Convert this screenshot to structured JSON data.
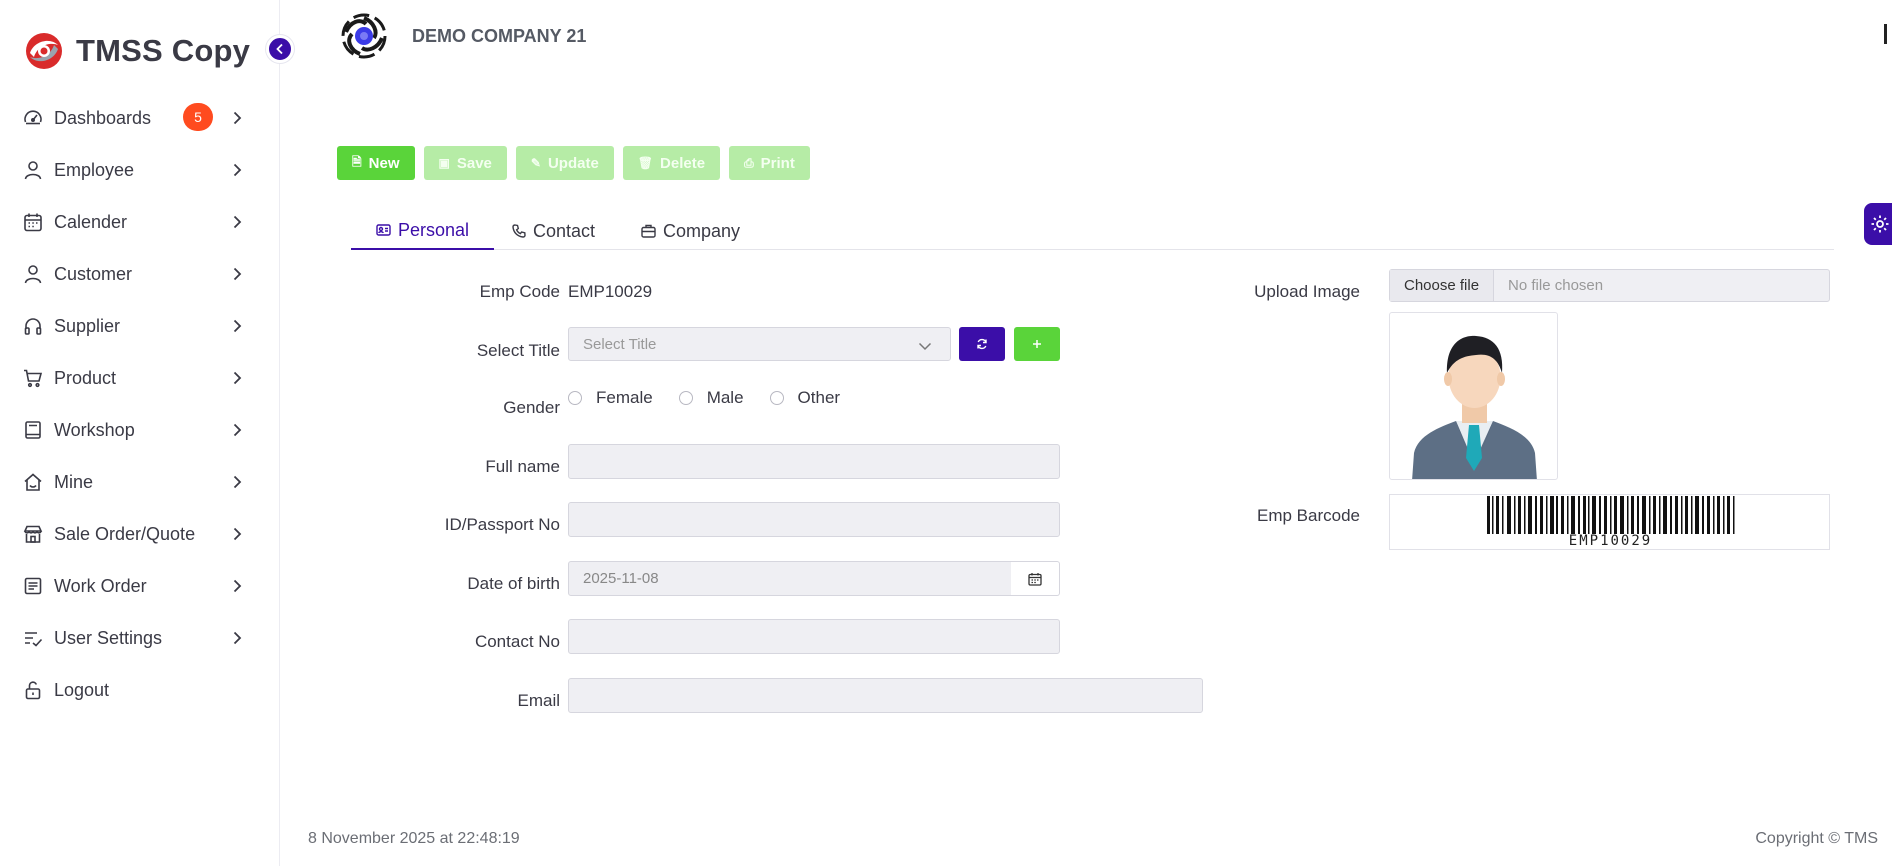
{
  "brand": {
    "name": "TMSS Copy"
  },
  "header": {
    "company": "DEMO COMPANY 21"
  },
  "sidebar": {
    "items": [
      {
        "label": "Dashboards",
        "icon": "speedometer-icon",
        "badge": "5"
      },
      {
        "label": "Employee",
        "icon": "person-icon"
      },
      {
        "label": "Calender",
        "icon": "calendar-icon"
      },
      {
        "label": "Customer",
        "icon": "person-icon"
      },
      {
        "label": "Supplier",
        "icon": "headphones-icon"
      },
      {
        "label": "Product",
        "icon": "cart-icon"
      },
      {
        "label": "Workshop",
        "icon": "book-icon"
      },
      {
        "label": "Mine",
        "icon": "home-icon"
      },
      {
        "label": "Sale Order/Quote",
        "icon": "shop-icon"
      },
      {
        "label": "Work Order",
        "icon": "document-icon"
      },
      {
        "label": "User Settings",
        "icon": "list-check-icon"
      },
      {
        "label": "Logout",
        "icon": "unlock-icon"
      }
    ]
  },
  "toolbar": {
    "new": "New",
    "save": "Save",
    "update": "Update",
    "delete": "Delete",
    "print": "Print"
  },
  "tabs": {
    "personal": "Personal",
    "contact": "Contact",
    "company": "Company"
  },
  "form": {
    "emp_code_label": "Emp Code",
    "emp_code_value": "EMP10029",
    "title_label": "Select Title",
    "title_placeholder": "Select Title",
    "gender_label": "Gender",
    "gender_options": [
      "Female",
      "Male",
      "Other"
    ],
    "fullname_label": "Full name",
    "passport_label": "ID/Passport No",
    "dob_label": "Date of birth",
    "dob_value": "2025-11-08",
    "contact_label": "Contact No",
    "email_label": "Email"
  },
  "right_panel": {
    "upload_label": "Upload Image",
    "choose_file": "Choose file",
    "no_file": "No file chosen",
    "barcode_label": "Emp Barcode",
    "barcode_text": "EMP10029"
  },
  "footer": {
    "timestamp": "8 November 2025 at 22:48:19",
    "copyright": "Copyright © TMS"
  },
  "colors": {
    "primary": "#3b0ea8",
    "success": "#5ad43a",
    "success_disabled": "#b6eca6",
    "badge": "#ff4b1f"
  }
}
